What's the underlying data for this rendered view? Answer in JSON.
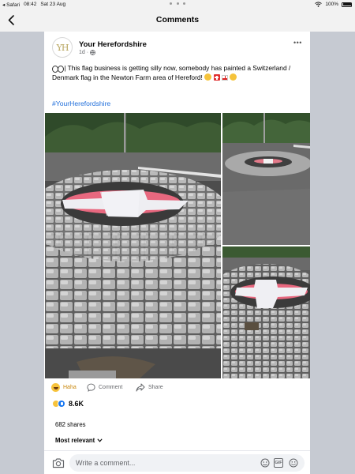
{
  "status_bar": {
    "back_app": "◂ Safari",
    "time": "08:42",
    "date": "Sat 23 Aug",
    "battery": "100%"
  },
  "nav": {
    "title": "Comments"
  },
  "post": {
    "avatar_text": "YH",
    "page_name": "Your Herefordshire",
    "time_ago": "1d",
    "text_main": " | This flag business is getting silly now, somebody has painted a Switzerland / Denmark flag in the Newton Farm area of Hereford! ",
    "hashtag": "#YourHerefordshire"
  },
  "actions": {
    "reaction_label": "Haha",
    "comment_label": "Comment",
    "share_label": "Share"
  },
  "stats": {
    "reaction_count": "8.6K",
    "shares": "682 shares"
  },
  "comments": {
    "sort_label": "Most relevant",
    "input_placeholder": "Write a comment..."
  },
  "colors": {
    "link_blue": "#216fdb",
    "haha_yellow": "#f7c33c",
    "painted_flag_red": "#e8687f"
  },
  "icons": [
    "back-chevron-icon",
    "wifi-icon",
    "battery-icon",
    "globe-icon",
    "more-dots-icon",
    "eyes-emoji-icon",
    "switzerland-flag-icon",
    "england-flag-icon",
    "laughing-emoji-icon",
    "haha-reaction-icon",
    "comment-icon",
    "share-icon",
    "like-reaction-icon",
    "chevron-down-icon",
    "camera-icon",
    "avatar-sticker-icon",
    "gif-icon",
    "emoji-icon"
  ]
}
